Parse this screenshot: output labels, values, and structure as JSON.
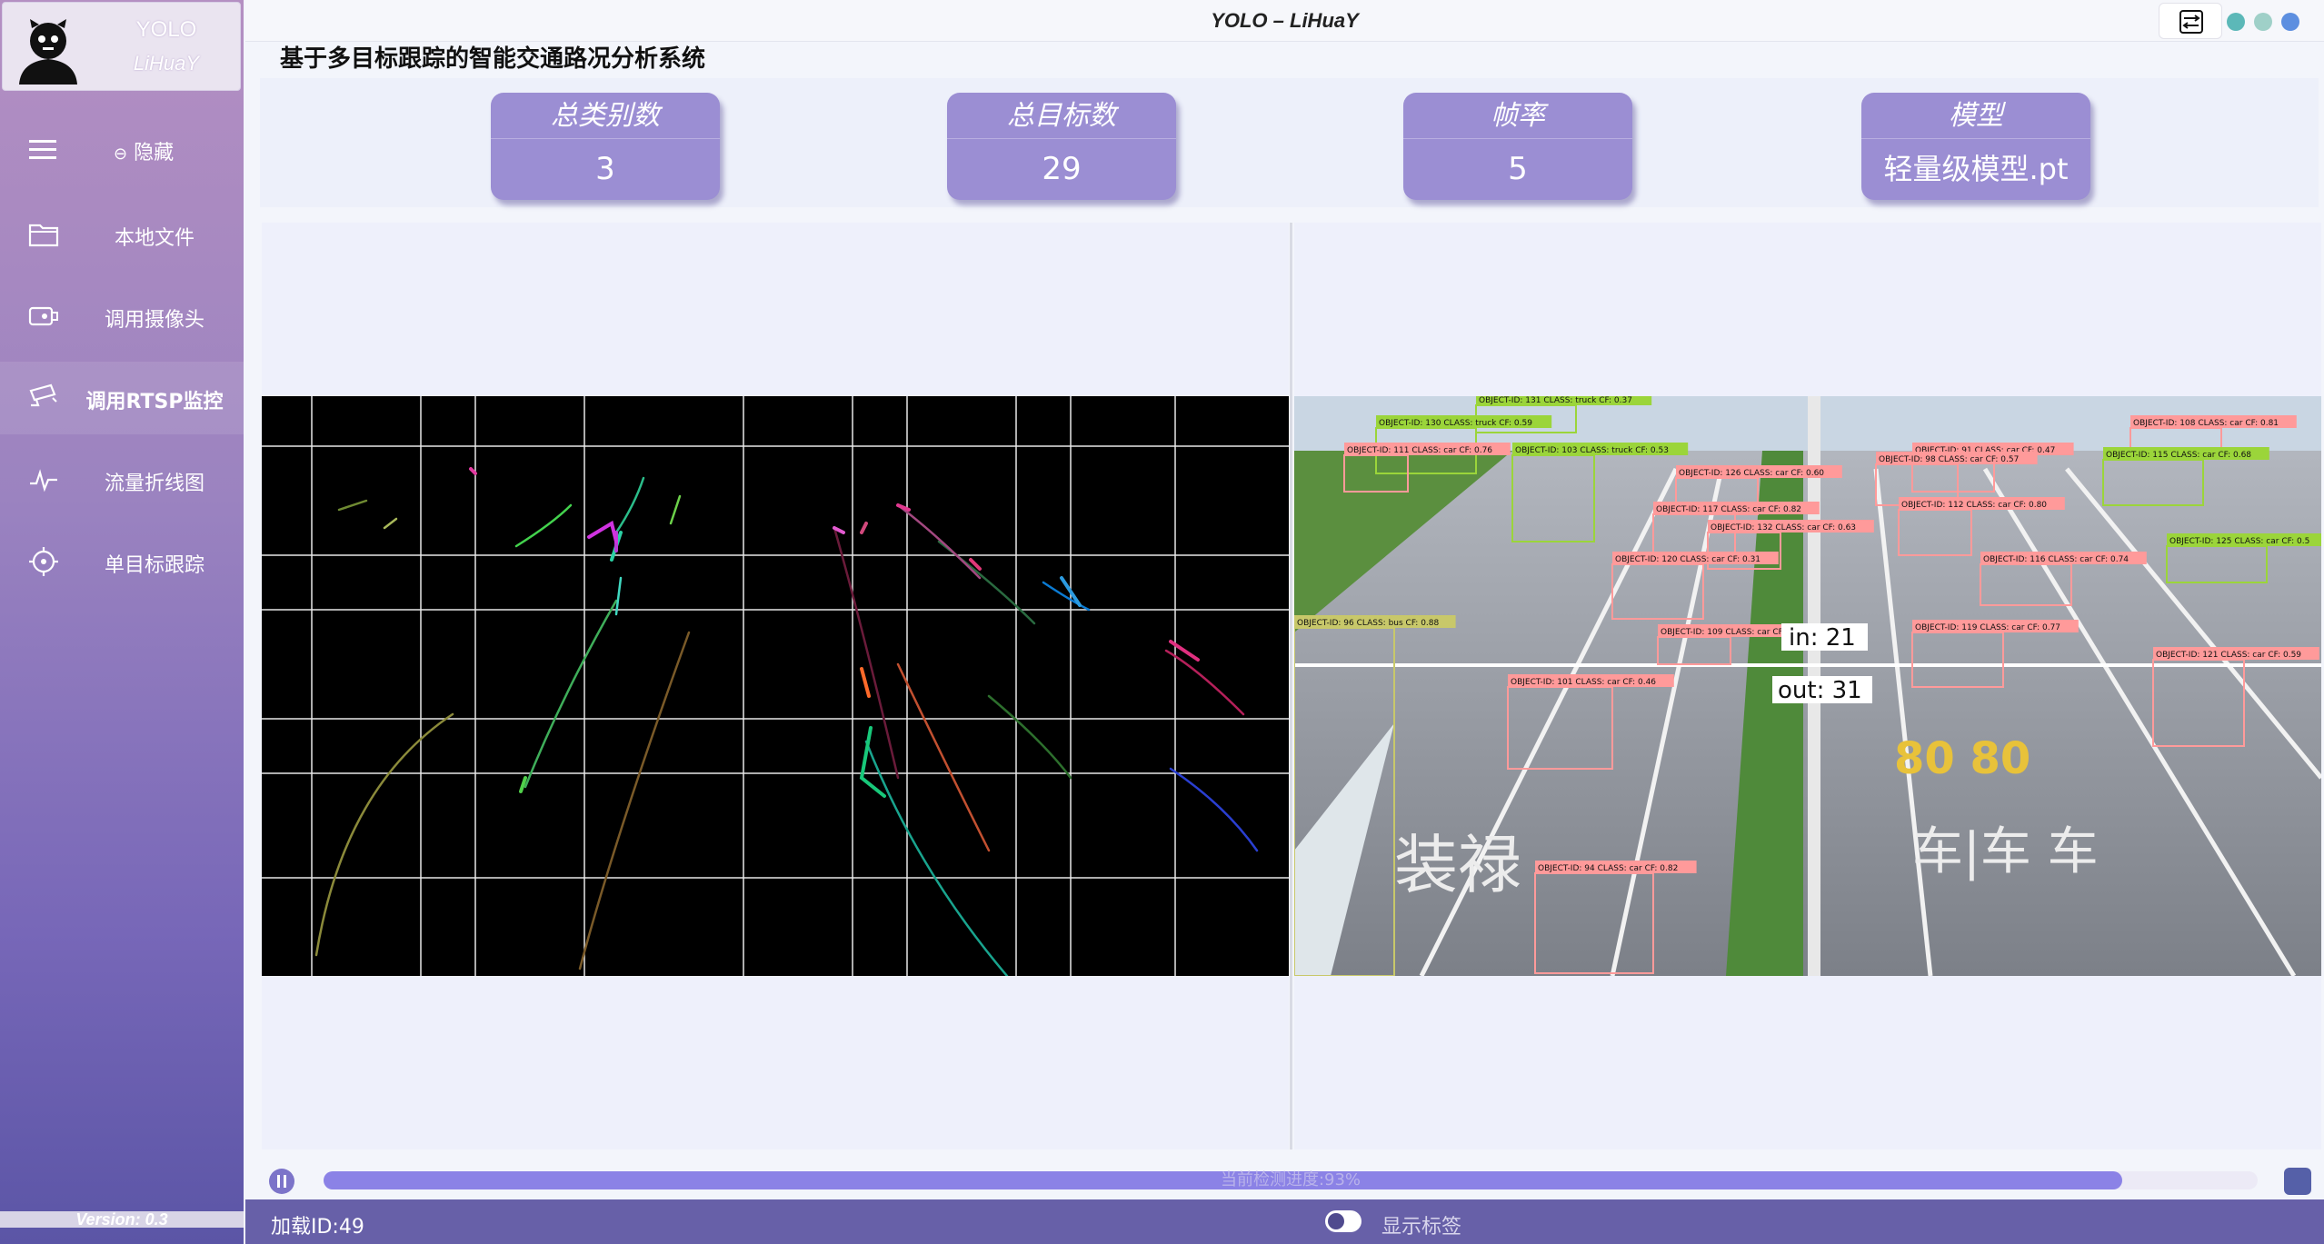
{
  "window": {
    "title": "YOLO  –  LiHuaY"
  },
  "brand": {
    "title": "YOLO",
    "subtitle": "LiHuaY"
  },
  "sidebar": {
    "hide_label": "隐藏",
    "items": [
      {
        "label": "本地文件",
        "icon": "folder-icon"
      },
      {
        "label": "调用摄像头",
        "icon": "camera-icon"
      },
      {
        "label": "调用RTSP监控",
        "icon": "cctv-icon"
      },
      {
        "label": "流量折线图",
        "icon": "line-chart-icon"
      },
      {
        "label": "单目标跟踪",
        "icon": "crosshair-icon"
      }
    ],
    "version": "Version: 0.3"
  },
  "app_title": "基于多目标跟踪的智能交通路况分析系统",
  "stats": [
    {
      "caption": "总类别数",
      "value": "3"
    },
    {
      "caption": "总目标数",
      "value": "29"
    },
    {
      "caption": "帧率",
      "value": "5"
    },
    {
      "caption": "模型",
      "value": "轻量级模型.pt"
    }
  ],
  "video": {
    "counter_in": "in: 21",
    "counter_out": "out: 31",
    "detections": [
      "OBJECT-ID: 131 CLASS: truck CF: 0.37",
      "OBJECT-ID: 130 CLASS: truck CF: 0.59",
      "OBJECT-ID: 111 CLASS: car CF: 0.76",
      "OBJECT-ID: 103 CLASS: truck CF: 0.53",
      "OBJECT-ID: 126 CLASS: car CF: 0.60",
      "OBJECT-ID: 91 CLASS: car CF: 0.47",
      "OBJECT-ID: 108 CLASS: car CF: 0.81",
      "OBJECT-ID: 98 CLASS: car CF: 0.57",
      "OBJECT-ID: 115 CLASS: car CF: 0.68",
      "OBJECT-ID: 112 CLASS: car CF: 0.80",
      "OBJECT-ID: 117 CLASS: car CF: 0.82",
      "OBJECT-ID: 132 CLASS: car CF: 0.63",
      "OBJECT-ID: 125 CLASS: car CF: 0.5",
      "OBJECT-ID: 120 CLASS: car CF: 0.31",
      "OBJECT-ID: 116 CLASS: car CF: 0.74",
      "OBJECT-ID: 96 CLASS: bus CF: 0.88",
      "OBJECT-ID: 109 CLASS: car CF: 0.37",
      "OBJECT-ID: 119 CLASS: car CF: 0.77",
      "OBJECT-ID: 121 CLASS: car CF: 0.59",
      "OBJECT-ID: 101 CLASS: car CF: 0.46",
      "OBJECT-ID: 94 CLASS: car CF: 0.82"
    ]
  },
  "progress": {
    "text": "当前检测进度:93%",
    "fraction": 0.93
  },
  "statusbar": {
    "load_id": "加载ID:49",
    "toggle_label": "显示标签"
  },
  "colors": {
    "accent": "#9b8ed3",
    "sidebar_top": "#b48fc2",
    "sidebar_bottom": "#5b55a6",
    "status": "#6760a8"
  }
}
